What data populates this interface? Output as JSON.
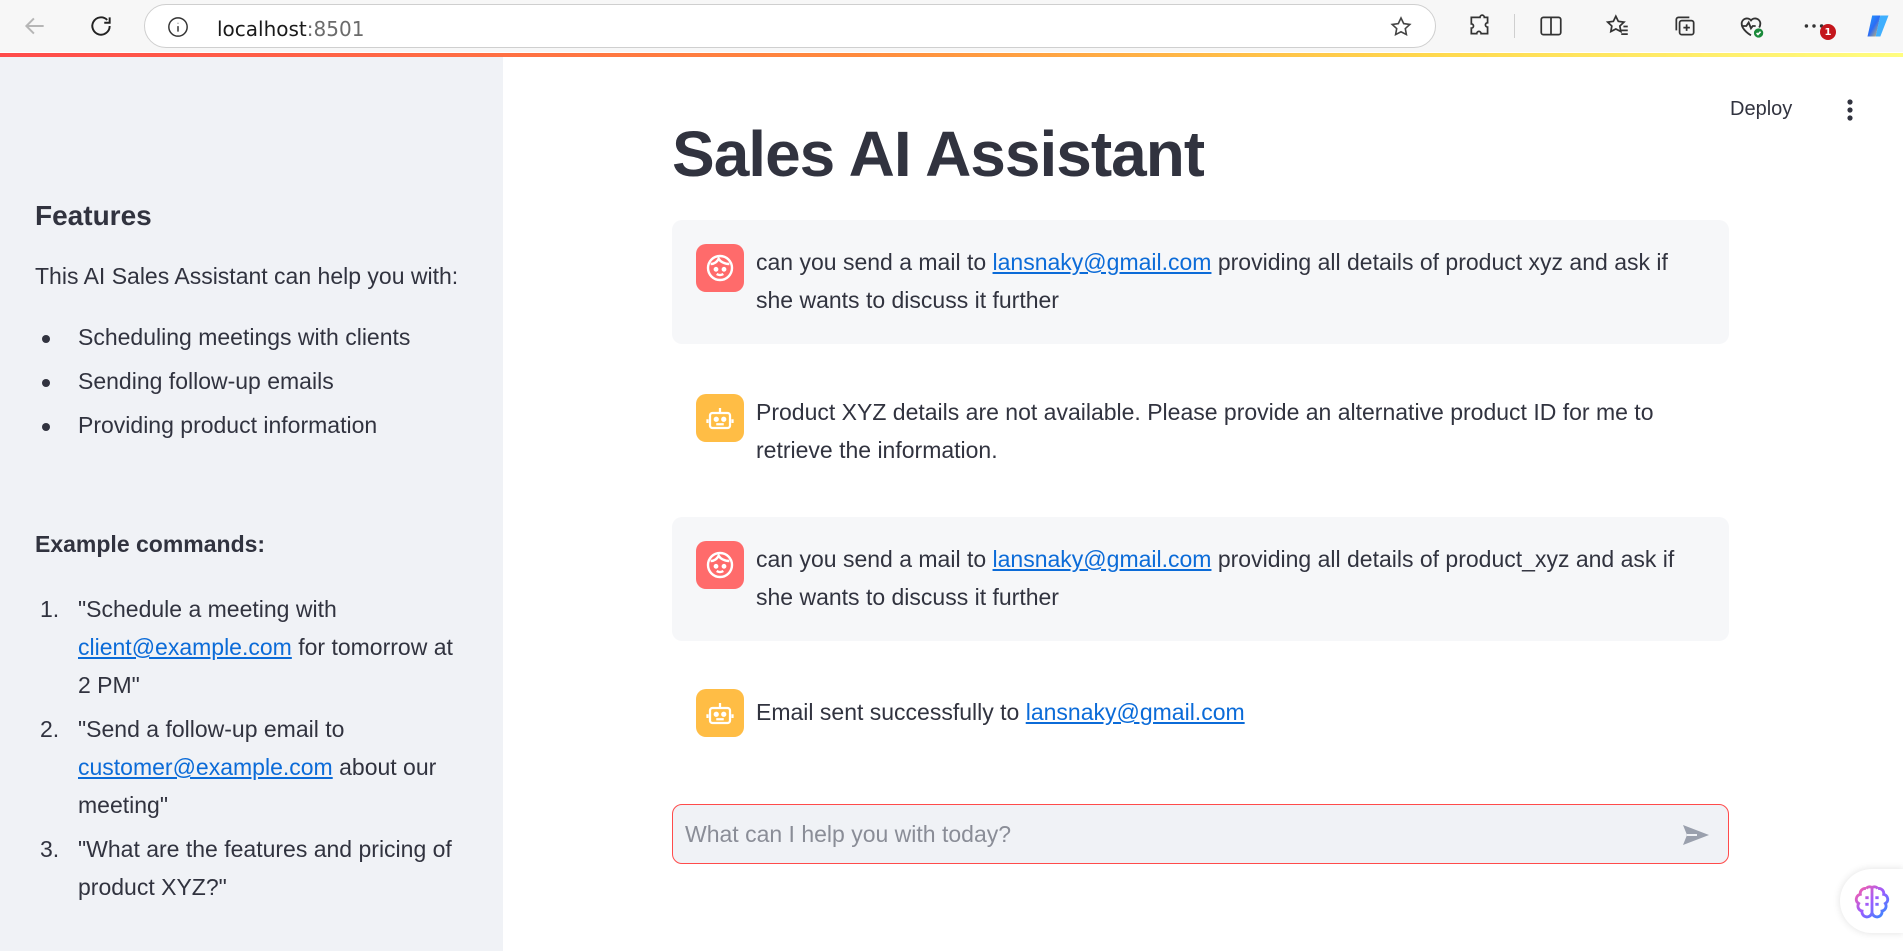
{
  "browser": {
    "url_host": "localhost",
    "url_port": ":8501",
    "notification_count": "1"
  },
  "sidebar": {
    "heading": "Features",
    "intro": "This AI Sales Assistant can help you with:",
    "features": [
      "Scheduling meetings with clients",
      "Sending follow-up emails",
      "Providing product information"
    ],
    "examples_title": "Example commands:",
    "examples": [
      {
        "num": "1.",
        "before": "\"Schedule a meeting with ",
        "link": "client@example.com",
        "after": " for tomorrow at 2 PM\""
      },
      {
        "num": "2.",
        "before": "\"Send a follow-up email to ",
        "link": "customer@example.com",
        "after": " about our meeting\""
      },
      {
        "num": "3.",
        "before": "\"What are the features and pricing of product XYZ?\"",
        "link": "",
        "after": ""
      }
    ]
  },
  "header": {
    "deploy_label": "Deploy"
  },
  "main": {
    "title": "Sales AI Assistant",
    "messages": [
      {
        "role": "user",
        "before": "can you send a mail to ",
        "link": "lansnaky@gmail.com",
        "after": " providing all details of product xyz and ask if she wants to discuss it further"
      },
      {
        "role": "assistant",
        "before": "Product XYZ details are not available. Please provide an alternative product ID for me to retrieve the information.",
        "link": "",
        "after": ""
      },
      {
        "role": "user",
        "before": "can you send a mail to ",
        "link": "lansnaky@gmail.com",
        "after": " providing all details of product_xyz and ask if she wants to discuss it further"
      },
      {
        "role": "assistant",
        "before": "Email sent successfully to ",
        "link": "lansnaky@gmail.com",
        "after": ""
      }
    ],
    "input_placeholder": "What can I help you with today?"
  },
  "colors": {
    "accent": "#ff4b4b",
    "user_avatar": "#ff6b6b",
    "bot_avatar": "#ffbd45",
    "sidebar_bg": "#f0f2f6",
    "link": "#0b6bd8"
  },
  "icons": [
    "back-arrow-icon",
    "refresh-icon",
    "info-icon",
    "star-icon",
    "extensions-icon",
    "split-screen-icon",
    "favorites-icon",
    "collections-icon",
    "browser-essentials-icon",
    "more-icon",
    "copilot-icon",
    "kebab-menu-icon",
    "user-face-icon",
    "robot-icon",
    "send-icon",
    "brain-icon"
  ]
}
